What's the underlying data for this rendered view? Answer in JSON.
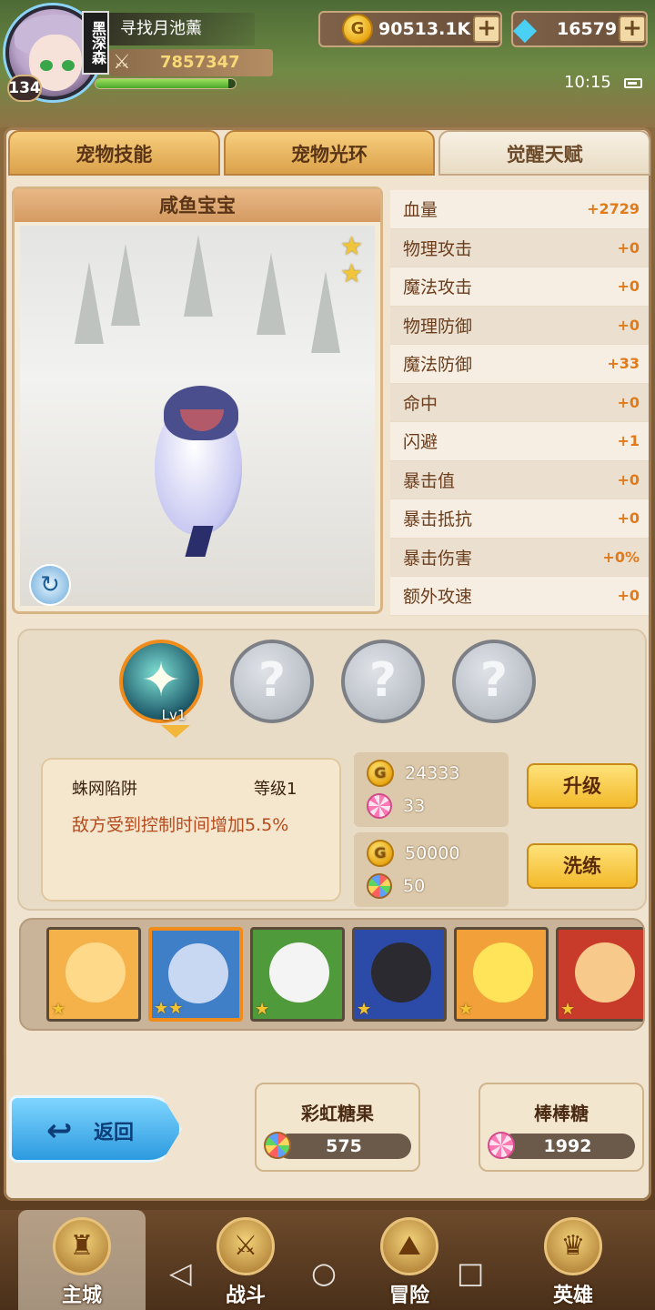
{
  "player": {
    "name": "寻找月池薰",
    "level": "134",
    "rank_label": "黑深森",
    "power": "7857347",
    "hp_fraction": 0.95
  },
  "resources": {
    "gold": "90513.1K",
    "gems": "16579",
    "plus_label": "+"
  },
  "status_bar": {
    "time": "10:15"
  },
  "tabs": [
    {
      "label": "宠物技能"
    },
    {
      "label": "宠物光环"
    },
    {
      "label": "觉醒天赋"
    }
  ],
  "pet": {
    "name": "咸鱼宝宝",
    "stars": 2
  },
  "stats": [
    {
      "name": "血量",
      "value": "+2729"
    },
    {
      "name": "物理攻击",
      "value": "+0"
    },
    {
      "name": "魔法攻击",
      "value": "+0"
    },
    {
      "name": "物理防御",
      "value": "+0"
    },
    {
      "name": "魔法防御",
      "value": "+33"
    },
    {
      "name": "命中",
      "value": "+0"
    },
    {
      "name": "闪避",
      "value": "+1"
    },
    {
      "name": "暴击值",
      "value": "+0"
    },
    {
      "name": "暴击抵抗",
      "value": "+0"
    },
    {
      "name": "暴击伤害",
      "value": "+0%"
    },
    {
      "name": "额外攻速",
      "value": "+0"
    }
  ],
  "skill": {
    "slot_level_label": "Lv1",
    "locked_symbol": "?",
    "name": "蛛网陷阱",
    "level_text": "等级1",
    "description": "敌方受到控制时间增加5.5%",
    "upgrade": {
      "gold": "24333",
      "candy": "33",
      "button": "升级"
    },
    "refine": {
      "gold": "50000",
      "candy": "50",
      "button": "洗练"
    }
  },
  "pet_list": [
    {
      "name": "lion-pet",
      "stars": 1,
      "bg": "#f5b24a",
      "face": "#ffd98a"
    },
    {
      "name": "salted-fish-pet",
      "stars": 2,
      "bg": "#3f7fc8",
      "face": "#c9d8f2"
    },
    {
      "name": "panda-pet",
      "stars": 1,
      "bg": "#4f9a3a",
      "face": "#f4f4f4"
    },
    {
      "name": "black-dragon-pet",
      "stars": 1,
      "bg": "#2c4aa8",
      "face": "#2a2a30"
    },
    {
      "name": "yellow-chick-pet",
      "stars": 1,
      "bg": "#f2a13a",
      "face": "#ffe45a"
    },
    {
      "name": "cat-pet",
      "stars": 1,
      "bg": "#c83a2a",
      "face": "#f7c98a"
    }
  ],
  "actions": {
    "back": "返回",
    "rainbow_candy": {
      "label": "彩虹糖果",
      "count": "575"
    },
    "lollipop": {
      "label": "棒棒糖",
      "count": "1992"
    }
  },
  "bottom_nav": [
    {
      "label": "主城",
      "icon": "castle-icon"
    },
    {
      "label": "战斗",
      "icon": "crossed-swords-icon"
    },
    {
      "label": "冒险",
      "icon": "map-icon"
    },
    {
      "label": "英雄",
      "icon": "hero-helmet-icon"
    }
  ],
  "colors": {
    "accent_orange": "#e07a1a",
    "tab_gold": "#f7cf7d",
    "button_yellow": "#ffe27a",
    "back_blue": "#2c9adf"
  }
}
